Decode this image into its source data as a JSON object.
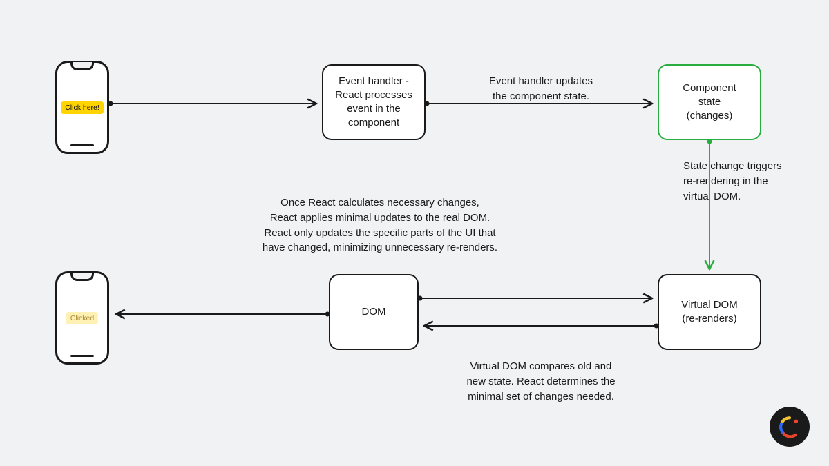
{
  "phones": {
    "before": {
      "button_text": "Click here!"
    },
    "after": {
      "button_text": "Clicked"
    }
  },
  "nodes": {
    "event_handler": "Event handler -\nReact processes\nevent in the\ncomponent",
    "component_state": "Component\nstate\n(changes)",
    "virtual_dom": "Virtual DOM\n(re-renders)",
    "dom": "DOM"
  },
  "arrows": {
    "a1": "",
    "a2": "Event handler updates\nthe component state.",
    "a3": "State change triggers\nre-rendering in the\nvirtual DOM.",
    "a4": "Virtual DOM compares old and\nnew state. React determines the\nminimal set of changes needed.",
    "a5": "Once React calculates necessary changes,\nReact applies minimal updates to the real DOM.\nReact only updates the specific parts of the UI that\nhave changed, minimizing unnecessary re-renders.",
    "a6": ""
  },
  "colors": {
    "node_border": "#1a1a1a",
    "state_border": "#27ae3e",
    "arrow": "#1a1a1a",
    "state_arrow": "#27ae3e",
    "button_active": "#ffd400",
    "button_faded": "#fff0b3"
  }
}
